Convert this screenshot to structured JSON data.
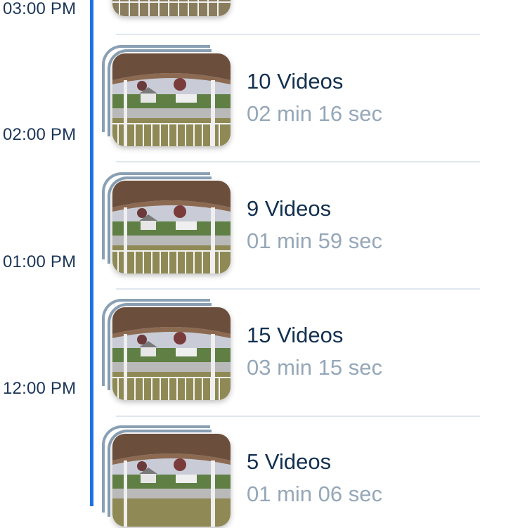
{
  "timeline": {
    "accent_color": "#1f6fe5",
    "time_labels": [
      "03:00 PM",
      "02:00 PM",
      "01:00 PM",
      "12:00 PM"
    ]
  },
  "events": [
    {
      "title": "10 Videos",
      "duration": "02 min 16 sec",
      "icon": "doorbell-camera-thumbnail"
    },
    {
      "title": "9 Videos",
      "duration": "01 min 59 sec",
      "icon": "doorbell-camera-thumbnail"
    },
    {
      "title": "15 Videos",
      "duration": "03 min 15 sec",
      "icon": "doorbell-camera-thumbnail"
    },
    {
      "title": "5 Videos",
      "duration": "01 min 06 sec",
      "icon": "doorbell-camera-thumbnail"
    }
  ]
}
